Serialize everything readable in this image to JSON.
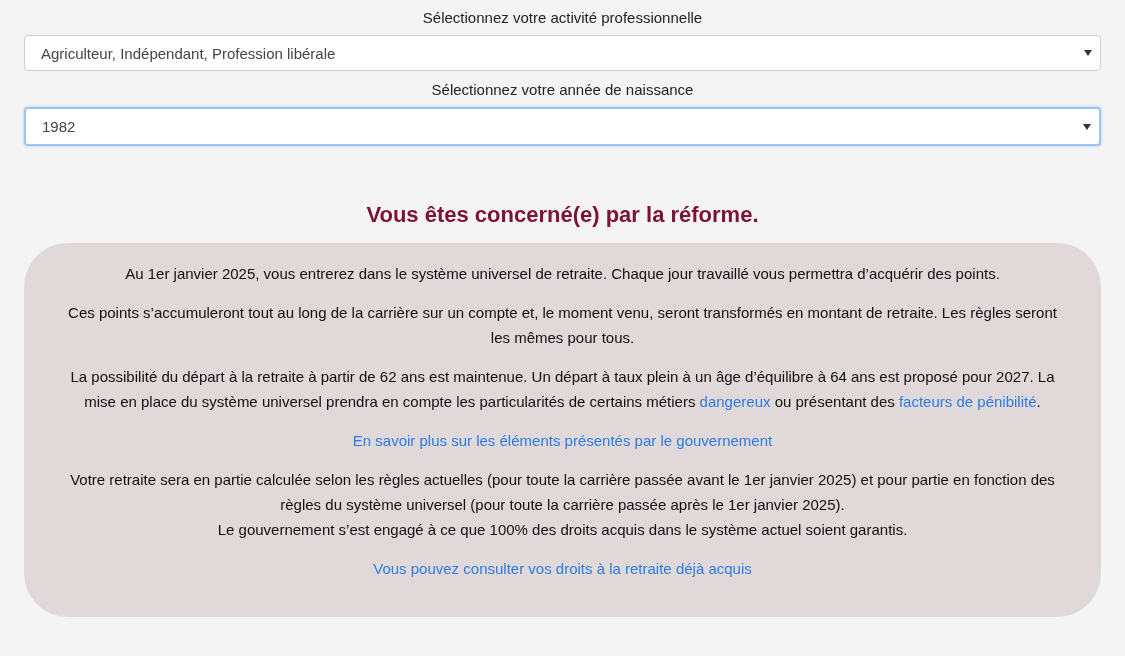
{
  "selects": [
    {
      "label": "Sélectionnez votre activité professionnelle",
      "value": "Agriculteur, Indépendant, Profession libérale",
      "focused": false
    },
    {
      "label": "Sélectionnez votre année de naissance",
      "value": "1982",
      "focused": true
    }
  ],
  "result": {
    "heading": "Vous êtes concerné(e) par la réforme.",
    "blocks": [
      {
        "kind": "paragraph",
        "lines": [
          [
            {
              "kind": "text",
              "text": "Au 1er janvier 2025, vous entrerez dans le système universel de retraite. Chaque jour travaillé vous permettra d’acquérir des points."
            }
          ]
        ]
      },
      {
        "kind": "paragraph",
        "lines": [
          [
            {
              "kind": "text",
              "text": "Ces points s’accumuleront tout au long de la carrière sur un compte et, le moment venu, seront transformés en montant de retraite. Les règles seront les mêmes pour tous."
            }
          ]
        ]
      },
      {
        "kind": "paragraph",
        "lines": [
          [
            {
              "kind": "text",
              "text": "La possibilité du départ à la retraite à partir de 62 ans est maintenue. Un départ à taux plein à un âge d’équilibre à 64 ans est proposé pour 2027. La mise en place du système universel prendra en compte les particularités de certains métiers "
            },
            {
              "kind": "link",
              "text": "dangereux"
            },
            {
              "kind": "text",
              "text": " ou présentant des "
            },
            {
              "kind": "link",
              "text": "facteurs de pénibilité"
            },
            {
              "kind": "text",
              "text": "."
            }
          ]
        ]
      },
      {
        "kind": "link",
        "text": "En savoir plus sur les éléments présentés par le gouvernement"
      },
      {
        "kind": "paragraph",
        "lines": [
          [
            {
              "kind": "text",
              "text": "Votre retraite sera en partie calculée selon les règles actuelles (pour toute la carrière passée avant le 1er janvier 2025) et pour partie en fonction des règles du système universel (pour toute la carrière passée après le 1er janvier 2025)."
            }
          ],
          [
            {
              "kind": "text",
              "text": "Le gouvernement s’est engagé à ce que 100% des droits acquis dans le système actuel soient garantis."
            }
          ]
        ]
      },
      {
        "kind": "link",
        "text": "Vous pouvez consulter vos droits à la retraite déjà acquis"
      }
    ]
  }
}
